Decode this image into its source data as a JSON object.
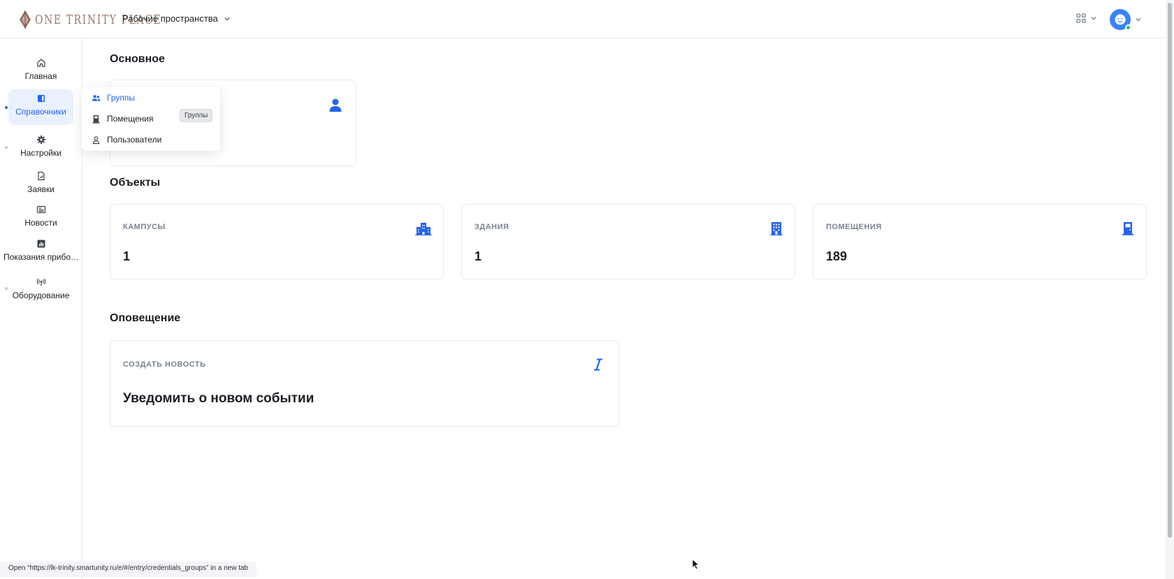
{
  "header": {
    "logo_text": "ONE TRINITY PLACE",
    "workspace_label": "Рабочие пространства"
  },
  "sidebar": {
    "items": [
      {
        "label": "Главная",
        "icon": "home-icon"
      },
      {
        "label": "Справочники",
        "icon": "book-icon",
        "active": true
      },
      {
        "label": "Настройки",
        "icon": "gear-icon"
      },
      {
        "label": "Заявки",
        "icon": "document-icon"
      },
      {
        "label": "Новости",
        "icon": "newspaper-icon"
      },
      {
        "label": "Показания прибо…",
        "icon": "bar-chart-icon"
      },
      {
        "label": "Оборудование",
        "icon": "antenna-icon"
      }
    ]
  },
  "submenu": {
    "items": [
      {
        "label": "Группы",
        "icon": "users-icon",
        "selected": true
      },
      {
        "label": "Помещения",
        "icon": "door-icon"
      },
      {
        "label": "Пользователи",
        "icon": "user-icon"
      }
    ],
    "tooltip": "Группы"
  },
  "main": {
    "basic_title": "Основное",
    "objects_title": "Объекты",
    "objects": [
      {
        "label": "КАМПУСЫ",
        "value": "1",
        "icon": "campus-icon"
      },
      {
        "label": "ЗДАНИЯ",
        "value": "1",
        "icon": "building-icon"
      },
      {
        "label": "ПОМЕЩЕНИЯ",
        "value": "189",
        "icon": "door-icon"
      }
    ],
    "notify_title": "Оповещение",
    "notify_card": {
      "label": "СОЗДАТЬ НОВОСТЬ",
      "title": "Уведомить о новом событии",
      "icon": "italic-i-icon"
    }
  },
  "statusbar": {
    "text": "Open “https://lk-trinity.smartunity.ru/e/#/entry/credentials_groups” in a new tab"
  },
  "colors": {
    "accent": "#2563eb",
    "online": "#22c55e"
  }
}
